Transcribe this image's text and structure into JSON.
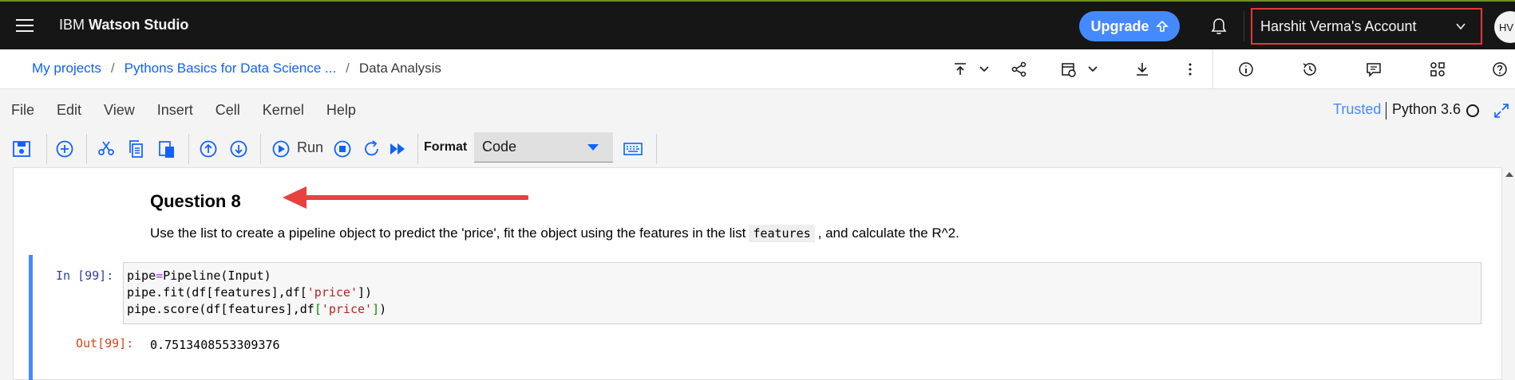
{
  "header": {
    "brand_prefix": "IBM",
    "brand_name": "Watson Studio",
    "upgrade_label": "Upgrade",
    "account_label": "Harshit Verma's Account",
    "avatar_initials": "HV"
  },
  "breadcrumb": {
    "items": [
      "My projects",
      "Pythons Basics for Data Science ...",
      "Data Analysis"
    ]
  },
  "menu": {
    "items": [
      "File",
      "Edit",
      "View",
      "Insert",
      "Cell",
      "Kernel",
      "Help"
    ],
    "trusted_label": "Trusted",
    "kernel_label": "Python 3.6"
  },
  "toolbar": {
    "run_label": "Run",
    "format_label": "Format",
    "format_value": "Code"
  },
  "notebook": {
    "question_title": "Question 8",
    "question_text_before": "Use the list to create a pipeline object to predict the 'price', fit the object using the features in the list",
    "question_code": "features",
    "question_text_after": ", and calculate the R^2.",
    "in_prompt": "In [99]:",
    "out_prompt": "Out[99]:",
    "output_value": "0.7513408553309376"
  },
  "colors": {
    "accent": "#4589ff",
    "account_highlight": "#e03a3a",
    "annotation_arrow": "#e8413f"
  }
}
